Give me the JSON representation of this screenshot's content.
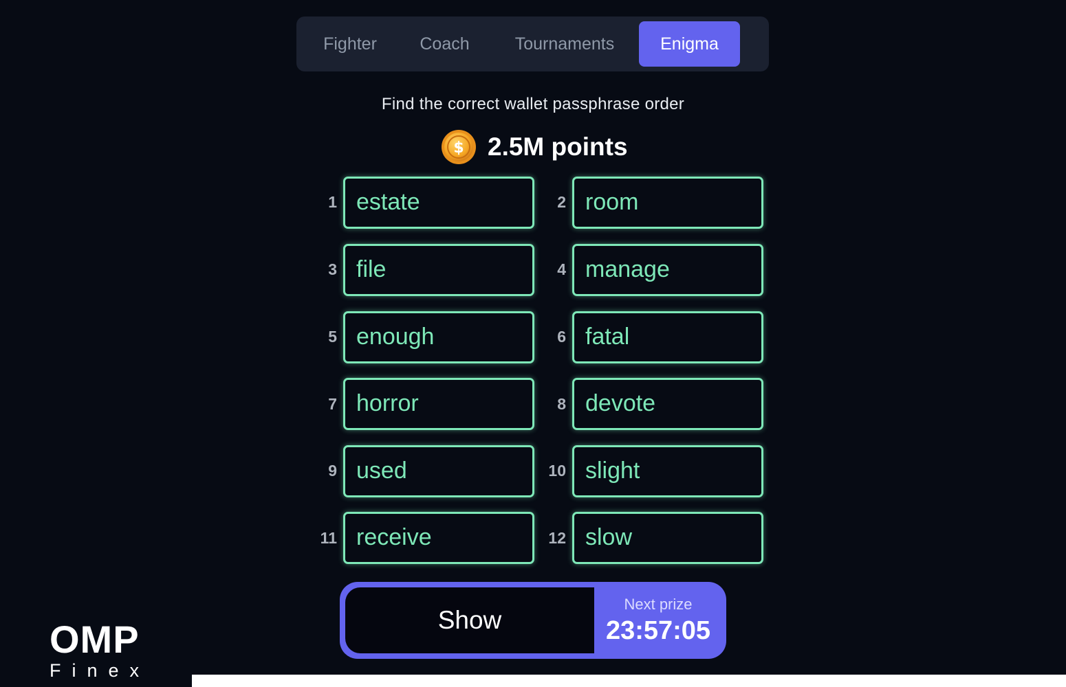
{
  "tabs": [
    {
      "label": "Fighter"
    },
    {
      "label": "Coach"
    },
    {
      "label": "Tournaments"
    },
    {
      "label": "Enigma",
      "active": true
    }
  ],
  "subtitle": "Find the correct wallet passphrase order",
  "points": {
    "icon": "coin-dollar-icon",
    "text": "2.5M points"
  },
  "words": [
    {
      "num": "1",
      "word": "estate"
    },
    {
      "num": "2",
      "word": "room"
    },
    {
      "num": "3",
      "word": "file"
    },
    {
      "num": "4",
      "word": "manage"
    },
    {
      "num": "5",
      "word": "enough"
    },
    {
      "num": "6",
      "word": "fatal"
    },
    {
      "num": "7",
      "word": "horror"
    },
    {
      "num": "8",
      "word": "devote"
    },
    {
      "num": "9",
      "word": "used"
    },
    {
      "num": "10",
      "word": "slight"
    },
    {
      "num": "11",
      "word": "receive"
    },
    {
      "num": "12",
      "word": "slow"
    }
  ],
  "action": {
    "show_label": "Show",
    "next_prize_label": "Next prize",
    "timer": "23:57:05"
  },
  "logo": {
    "main": "OMP",
    "sub": "Finex"
  },
  "colors": {
    "background": "#070b14",
    "tab_bar": "#1b2130",
    "accent": "#6363ee",
    "word_border": "#7ee8b8"
  }
}
